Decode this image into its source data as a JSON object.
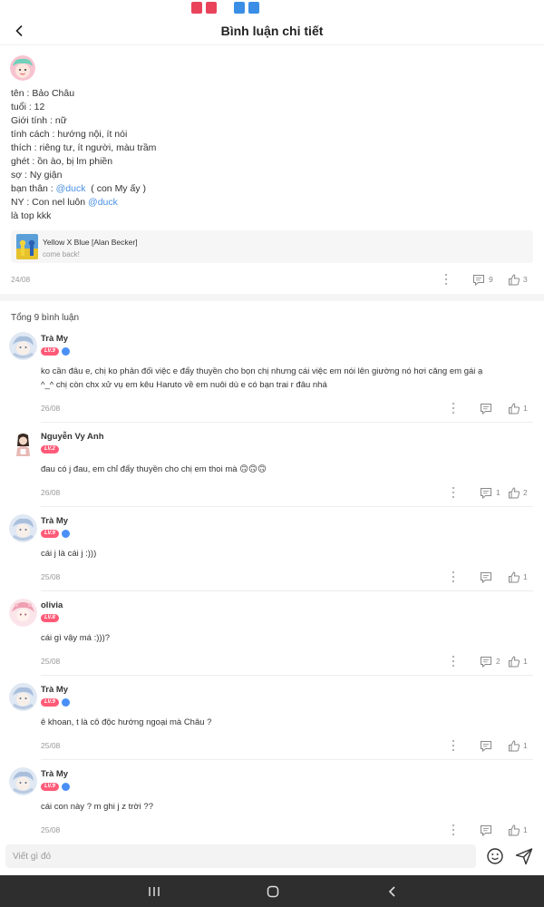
{
  "header": {
    "title": "Bình luận chi tiết"
  },
  "post": {
    "lines": [
      "tên : Bảo Châu",
      "tuổi : 12",
      "Giới tính : nữ",
      "tính cách : hướng nội, ít nói",
      "thích : riêng tư, ít người, màu trầm",
      "ghét : ồn ào, bị lm phiền",
      "sợ : Ny giận"
    ],
    "bff_prefix": "bạn thân : ",
    "bff_mention": "@duck",
    "bff_suffix": "  ( con My ấy )",
    "ny_prefix": "NY : Con nel luôn ",
    "ny_mention": "@duck",
    "last_line": "là top kkk",
    "music": {
      "title": "Yellow X Blue [Alan Becker]",
      "subtitle": "come back!"
    },
    "date": "24/08",
    "comment_count": "9",
    "like_count": "3"
  },
  "total_label": "Tổng 9 bình luận",
  "comments": [
    {
      "name": "Trà My",
      "level": "LV.9",
      "text_lines": [
        "ko cần đâu e, chị ko phản đối việc e đẩy thuyền cho bọn chị nhưng cái việc em nói lên giường nó hơi căng em gái ạ",
        "^_^ chị còn chx xử vụ em kêu Haruto về em nuôi dù e có bạn trai r đâu nhá"
      ],
      "date": "26/08",
      "comments": "",
      "likes": "1"
    },
    {
      "name": "Nguyễn Vy Anh",
      "level": "LV.2",
      "text_lines": [
        "đau có j đau, em chỉ đẩy thuyền cho chị em thoi mà 🙃🙃🙃"
      ],
      "date": "26/08",
      "comments": "1",
      "likes": "2"
    },
    {
      "name": "Trà My",
      "level": "LV.9",
      "text_lines": [
        "cái j là cái j :)))"
      ],
      "date": "25/08",
      "comments": "",
      "likes": "1"
    },
    {
      "name": "olivia",
      "level": "LV.8",
      "text_lines": [
        "cái gì vậy má :)))?"
      ],
      "date": "25/08",
      "comments": "2",
      "likes": "1"
    },
    {
      "name": "Trà My",
      "level": "LV.9",
      "text_lines": [
        "ê khoan, t là cô độc hướng ngoại mà Châu ?"
      ],
      "date": "25/08",
      "comments": "",
      "likes": "1"
    },
    {
      "name": "Trà My",
      "level": "LV.9",
      "text_lines": [
        "cái con này ? m ghi j z trời ??"
      ],
      "date": "25/08",
      "comments": "",
      "likes": "1"
    }
  ],
  "input": {
    "placeholder": "Viết gì đó"
  },
  "colors": {
    "accent": "#ff5a78",
    "mention": "#4a90e2",
    "navbar": "#2e2e2e"
  }
}
